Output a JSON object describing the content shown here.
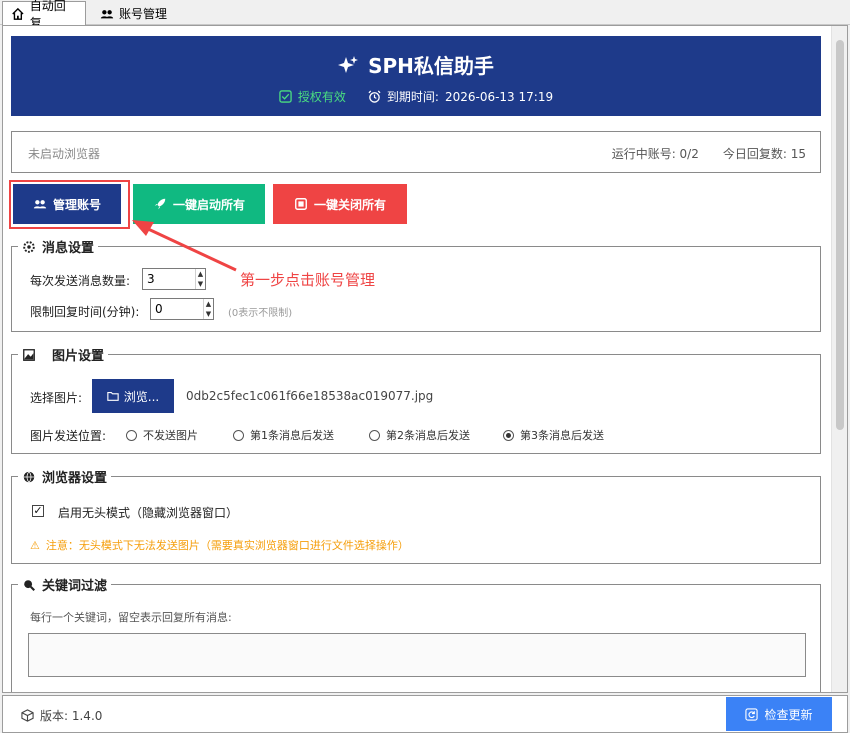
{
  "tabs": [
    {
      "label": "自动回复"
    },
    {
      "label": "账号管理"
    }
  ],
  "header": {
    "title": "SPH私信助手",
    "auth_status": "授权有效",
    "expire_label": "到期时间:",
    "expire_value": "2026-06-13 17:19"
  },
  "status": {
    "browser": "未启动浏览器",
    "running_accounts": "运行中账号: 0/2",
    "today_replies": "今日回复数: 15"
  },
  "actions": {
    "manage": "管理账号",
    "start_all": "一键启动所有",
    "stop_all": "一键关闭所有"
  },
  "annotation": "第一步点击账号管理",
  "message_settings": {
    "title": "消息设置",
    "per_send_label": "每次发送消息数量:",
    "per_send_value": "3",
    "limit_label": "限制回复时间(分钟):",
    "limit_value": "0",
    "limit_hint": "(0表示不限制)"
  },
  "image_settings": {
    "title": "图片设置",
    "select_label": "选择图片:",
    "browse_label": "浏览...",
    "file_name": "0db2c5fec1c061f66e18538ac019077.jpg",
    "position_label": "图片发送位置:",
    "options": [
      "不发送图片",
      "第1条消息后发送",
      "第2条消息后发送",
      "第3条消息后发送"
    ],
    "selected_index": 3
  },
  "browser_settings": {
    "title": "浏览器设置",
    "headless_label": "启用无头模式（隐藏浏览器窗口）",
    "headless_checked": true,
    "warning": "注意：无头模式下无法发送图片（需要真实浏览器窗口进行文件选择操作）"
  },
  "keyword_filter": {
    "title": "关键词过滤",
    "hint": "每行一个关键词，留空表示回复所有消息:"
  },
  "footer": {
    "version": "版本: 1.4.0",
    "update_label": "检查更新"
  },
  "colors": {
    "primary": "#1e3a8a",
    "success": "#10b981",
    "danger": "#ef4444",
    "warning": "#f59e0b",
    "accent": "#3b82f6"
  }
}
